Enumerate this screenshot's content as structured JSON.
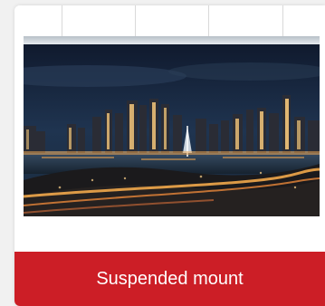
{
  "product": {
    "label": "Suspended mount",
    "image_subject": "city-night-skyline",
    "accent_color": "#cc1e26"
  }
}
